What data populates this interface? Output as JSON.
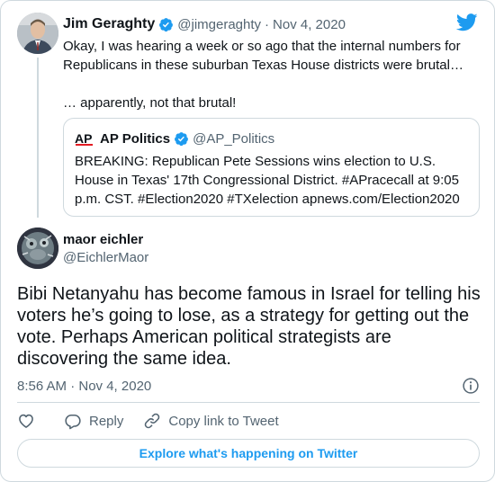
{
  "parent_tweet": {
    "author_name": "Jim Geraghty",
    "handle": "@jimgeraghty",
    "separator": "·",
    "date": "Nov 4, 2020",
    "text_line1": "Okay, I was hearing a week or so ago that the internal numbers for Republicans in these suburban Texas House districts were brutal…",
    "text_line2": "… apparently, not that brutal!",
    "verified": true
  },
  "quoted_tweet": {
    "logo_text": "AP",
    "author_name": "AP Politics",
    "handle": "@AP_Politics",
    "text": "BREAKING: Republican Pete Sessions wins election to U.S. House in Texas' 17th Congressional District. #APracecall at 9:05 p.m. CST. #Election2020 #TXelection apnews.com/Election2020",
    "verified": true
  },
  "main_tweet": {
    "author_name": "maor eichler",
    "handle": "@EichlerMaor",
    "text": "Bibi Netanyahu has become famous in Israel for telling his voters he’s going to lose, as a strategy for getting out the vote. Perhaps American political strategists are discovering the same idea.",
    "timestamp": "8:56 AM · Nov 4, 2020"
  },
  "actions": {
    "like_icon": "heart-icon",
    "reply_label": "Reply",
    "copy_link_label": "Copy link to Tweet"
  },
  "footer": {
    "explore_label": "Explore what's happening on Twitter"
  },
  "colors": {
    "accent": "#1d9bf0",
    "ap_red": "#e31b23",
    "secondary_text": "#536471",
    "border": "#cfd9de"
  }
}
